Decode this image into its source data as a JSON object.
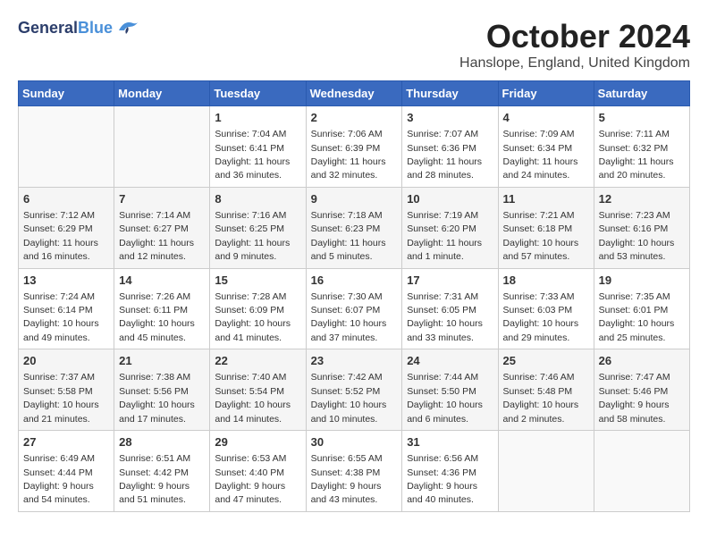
{
  "logo": {
    "general": "General",
    "blue": "Blue"
  },
  "title": {
    "month": "October 2024",
    "location": "Hanslope, England, United Kingdom"
  },
  "headers": [
    "Sunday",
    "Monday",
    "Tuesday",
    "Wednesday",
    "Thursday",
    "Friday",
    "Saturday"
  ],
  "weeks": [
    [
      {
        "day": "",
        "info": ""
      },
      {
        "day": "",
        "info": ""
      },
      {
        "day": "1",
        "info": "Sunrise: 7:04 AM\nSunset: 6:41 PM\nDaylight: 11 hours and 36 minutes."
      },
      {
        "day": "2",
        "info": "Sunrise: 7:06 AM\nSunset: 6:39 PM\nDaylight: 11 hours and 32 minutes."
      },
      {
        "day": "3",
        "info": "Sunrise: 7:07 AM\nSunset: 6:36 PM\nDaylight: 11 hours and 28 minutes."
      },
      {
        "day": "4",
        "info": "Sunrise: 7:09 AM\nSunset: 6:34 PM\nDaylight: 11 hours and 24 minutes."
      },
      {
        "day": "5",
        "info": "Sunrise: 7:11 AM\nSunset: 6:32 PM\nDaylight: 11 hours and 20 minutes."
      }
    ],
    [
      {
        "day": "6",
        "info": "Sunrise: 7:12 AM\nSunset: 6:29 PM\nDaylight: 11 hours and 16 minutes."
      },
      {
        "day": "7",
        "info": "Sunrise: 7:14 AM\nSunset: 6:27 PM\nDaylight: 11 hours and 12 minutes."
      },
      {
        "day": "8",
        "info": "Sunrise: 7:16 AM\nSunset: 6:25 PM\nDaylight: 11 hours and 9 minutes."
      },
      {
        "day": "9",
        "info": "Sunrise: 7:18 AM\nSunset: 6:23 PM\nDaylight: 11 hours and 5 minutes."
      },
      {
        "day": "10",
        "info": "Sunrise: 7:19 AM\nSunset: 6:20 PM\nDaylight: 11 hours and 1 minute."
      },
      {
        "day": "11",
        "info": "Sunrise: 7:21 AM\nSunset: 6:18 PM\nDaylight: 10 hours and 57 minutes."
      },
      {
        "day": "12",
        "info": "Sunrise: 7:23 AM\nSunset: 6:16 PM\nDaylight: 10 hours and 53 minutes."
      }
    ],
    [
      {
        "day": "13",
        "info": "Sunrise: 7:24 AM\nSunset: 6:14 PM\nDaylight: 10 hours and 49 minutes."
      },
      {
        "day": "14",
        "info": "Sunrise: 7:26 AM\nSunset: 6:11 PM\nDaylight: 10 hours and 45 minutes."
      },
      {
        "day": "15",
        "info": "Sunrise: 7:28 AM\nSunset: 6:09 PM\nDaylight: 10 hours and 41 minutes."
      },
      {
        "day": "16",
        "info": "Sunrise: 7:30 AM\nSunset: 6:07 PM\nDaylight: 10 hours and 37 minutes."
      },
      {
        "day": "17",
        "info": "Sunrise: 7:31 AM\nSunset: 6:05 PM\nDaylight: 10 hours and 33 minutes."
      },
      {
        "day": "18",
        "info": "Sunrise: 7:33 AM\nSunset: 6:03 PM\nDaylight: 10 hours and 29 minutes."
      },
      {
        "day": "19",
        "info": "Sunrise: 7:35 AM\nSunset: 6:01 PM\nDaylight: 10 hours and 25 minutes."
      }
    ],
    [
      {
        "day": "20",
        "info": "Sunrise: 7:37 AM\nSunset: 5:58 PM\nDaylight: 10 hours and 21 minutes."
      },
      {
        "day": "21",
        "info": "Sunrise: 7:38 AM\nSunset: 5:56 PM\nDaylight: 10 hours and 17 minutes."
      },
      {
        "day": "22",
        "info": "Sunrise: 7:40 AM\nSunset: 5:54 PM\nDaylight: 10 hours and 14 minutes."
      },
      {
        "day": "23",
        "info": "Sunrise: 7:42 AM\nSunset: 5:52 PM\nDaylight: 10 hours and 10 minutes."
      },
      {
        "day": "24",
        "info": "Sunrise: 7:44 AM\nSunset: 5:50 PM\nDaylight: 10 hours and 6 minutes."
      },
      {
        "day": "25",
        "info": "Sunrise: 7:46 AM\nSunset: 5:48 PM\nDaylight: 10 hours and 2 minutes."
      },
      {
        "day": "26",
        "info": "Sunrise: 7:47 AM\nSunset: 5:46 PM\nDaylight: 9 hours and 58 minutes."
      }
    ],
    [
      {
        "day": "27",
        "info": "Sunrise: 6:49 AM\nSunset: 4:44 PM\nDaylight: 9 hours and 54 minutes."
      },
      {
        "day": "28",
        "info": "Sunrise: 6:51 AM\nSunset: 4:42 PM\nDaylight: 9 hours and 51 minutes."
      },
      {
        "day": "29",
        "info": "Sunrise: 6:53 AM\nSunset: 4:40 PM\nDaylight: 9 hours and 47 minutes."
      },
      {
        "day": "30",
        "info": "Sunrise: 6:55 AM\nSunset: 4:38 PM\nDaylight: 9 hours and 43 minutes."
      },
      {
        "day": "31",
        "info": "Sunrise: 6:56 AM\nSunset: 4:36 PM\nDaylight: 9 hours and 40 minutes."
      },
      {
        "day": "",
        "info": ""
      },
      {
        "day": "",
        "info": ""
      }
    ]
  ]
}
